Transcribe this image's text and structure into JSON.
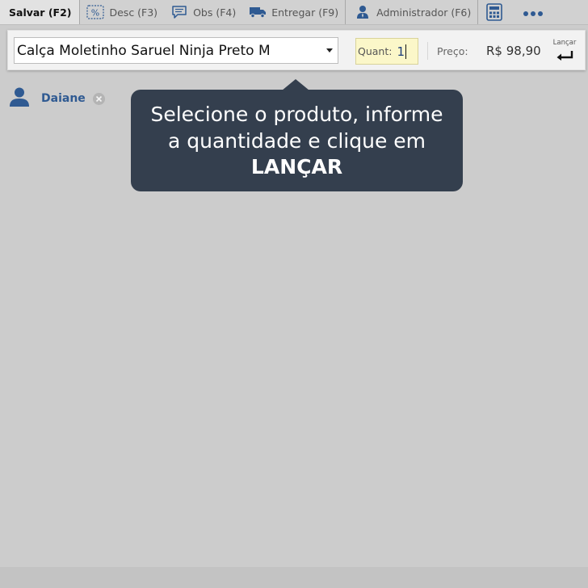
{
  "toolbar": {
    "save": "Salvar (F2)",
    "discount": "Desc (F3)",
    "notes": "Obs (F4)",
    "deliver": "Entregar (F9)",
    "admin": "Administrador (F6)"
  },
  "entry": {
    "product": "Calça Moletinho Saruel Ninja Preto M",
    "quantity_label": "Quant:",
    "quantity": "1",
    "price_label": "Preço:",
    "price": "R$ 98,90",
    "launch_label": "Lançar"
  },
  "customer": {
    "name": "Daiane"
  },
  "tooltip": {
    "line1": "Selecione o produto, informe",
    "line2": "a quantidade e clique em",
    "line3": "LANÇAR"
  },
  "icons": {
    "discount": "percent-icon",
    "notes": "speech-bubble-icon",
    "deliver": "truck-icon",
    "admin": "user-tie-icon",
    "calculator": "calculator-icon",
    "more": "ellipsis-icon",
    "launch": "enter-arrow-icon",
    "customer": "user-icon",
    "remove": "close-circle-icon"
  },
  "colors": {
    "accent": "#2f5a92",
    "tooltip_bg": "#343f4e",
    "quantity_bg": "#fbf7c9",
    "background": "#cccccc"
  }
}
